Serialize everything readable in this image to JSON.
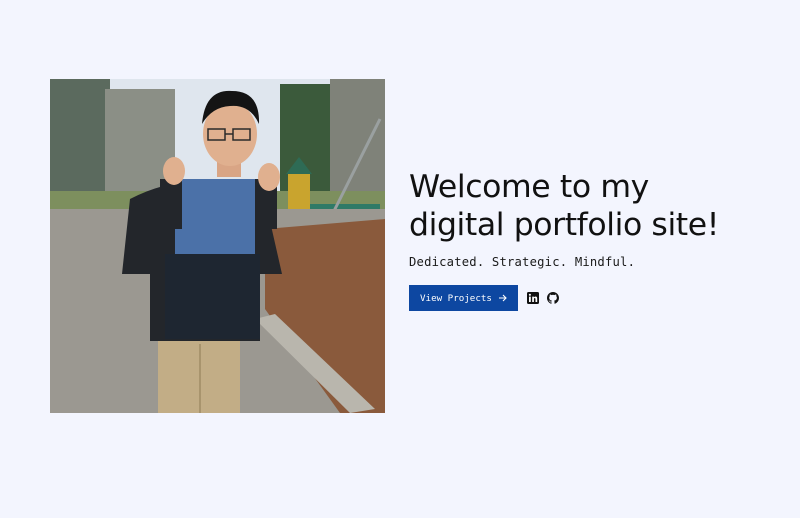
{
  "hero": {
    "headline_line1": "Welcome to my",
    "headline_line2": "digital portfolio site!",
    "tagline": "Dedicated. Strategic. Mindful.",
    "cta_label": "View Projects",
    "cta_icon": "arrow-right-icon",
    "social_links": [
      "linkedin-icon",
      "github-icon"
    ],
    "photo_alt": "Profile photo"
  },
  "colors": {
    "background": "#f3f5fe",
    "button": "#0d47a1",
    "text": "#111111"
  }
}
